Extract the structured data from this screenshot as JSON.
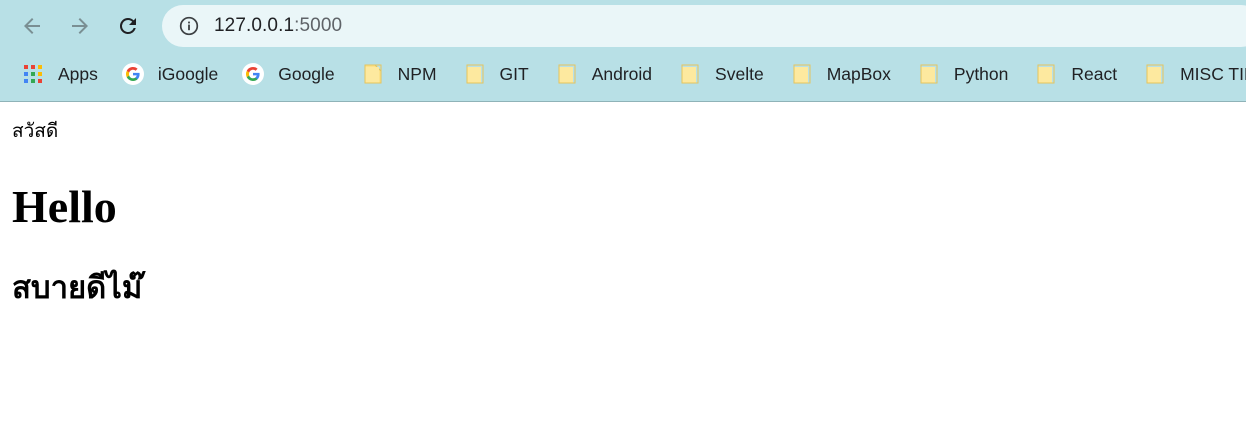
{
  "browser": {
    "url_host": "127.0.0.1",
    "url_port": ":5000",
    "bookmarks": [
      {
        "label": "Apps",
        "icon": "apps-grid-icon"
      },
      {
        "label": "iGoogle",
        "icon": "google-g-icon"
      },
      {
        "label": "Google",
        "icon": "google-g-icon"
      },
      {
        "label": "NPM",
        "icon": "folder-icon"
      },
      {
        "label": "GIT",
        "icon": "folder-icon"
      },
      {
        "label": "Android",
        "icon": "folder-icon"
      },
      {
        "label": "Svelte",
        "icon": "folder-icon"
      },
      {
        "label": "MapBox",
        "icon": "folder-icon"
      },
      {
        "label": "Python",
        "icon": "folder-icon"
      },
      {
        "label": "React",
        "icon": "folder-icon"
      },
      {
        "label": "MISC TIP",
        "icon": "folder-icon"
      }
    ],
    "colors": {
      "toolbar_bg": "#b8e0e6",
      "omnibox_bg": "#eaf6f8",
      "folder_yellow": "#fce28a"
    }
  },
  "page": {
    "paragraph": "สวัสดี",
    "heading1": "Hello",
    "heading2": "สบายดีไม๊"
  }
}
